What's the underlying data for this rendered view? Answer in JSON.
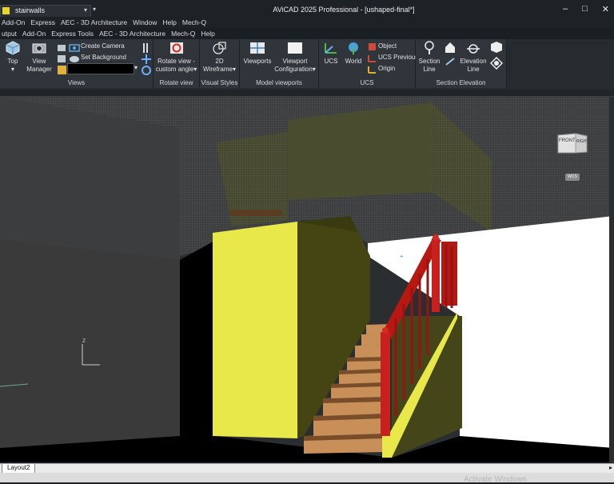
{
  "titlebar": {
    "layer_name": "stairwalls",
    "app_title": "AViCAD 2025 Professional - [ushaped-final*]",
    "controls": [
      "–",
      "□",
      "✕"
    ]
  },
  "menu_row1": [
    "Add-On",
    "Express",
    "AEC - 3D Architecture",
    "Window",
    "Help",
    "Mech-Q"
  ],
  "menu_row2": [
    "utput",
    "Add-On",
    "Express Tools",
    "AEC - 3D Architecture",
    "Mech-Q",
    "Help"
  ],
  "ribbon": {
    "views": {
      "label": "Views",
      "top": "Top",
      "view_manager": [
        "View",
        "Manager"
      ],
      "create_camera": "Create Camera",
      "set_background": "Set Background"
    },
    "rotate_view": {
      "label": "Rotate view",
      "button": [
        "Rotate view -",
        "custom angle"
      ]
    },
    "visual_styles": {
      "label": "Visual Styles",
      "button": [
        "2D",
        "Wireframe"
      ]
    },
    "model_viewports": {
      "label": "Model viewports",
      "viewports": "Viewports",
      "configuration": [
        "Viewport",
        "Configuration"
      ]
    },
    "ucs": {
      "label": "UCS",
      "ucs": "UCS",
      "world": "World",
      "object": "Object",
      "previous": "UCS Previous",
      "origin": "Origin"
    },
    "section_elevation": {
      "label": "Section  Elevation",
      "section": [
        "Section",
        "Line"
      ],
      "elevation": [
        "Elevation",
        "Line"
      ]
    }
  },
  "viewcube": {
    "front": "FRONT",
    "right": "RIGHT",
    "wcs": "WCS"
  },
  "bottom": {
    "layout_tab": "Layout2",
    "watermark": "Activate Windows"
  },
  "colors": {
    "wall_yellow": "#e8e84a",
    "wall_shadow": "#444513",
    "railing_red": "#c8201c",
    "tread": "#c89058"
  }
}
